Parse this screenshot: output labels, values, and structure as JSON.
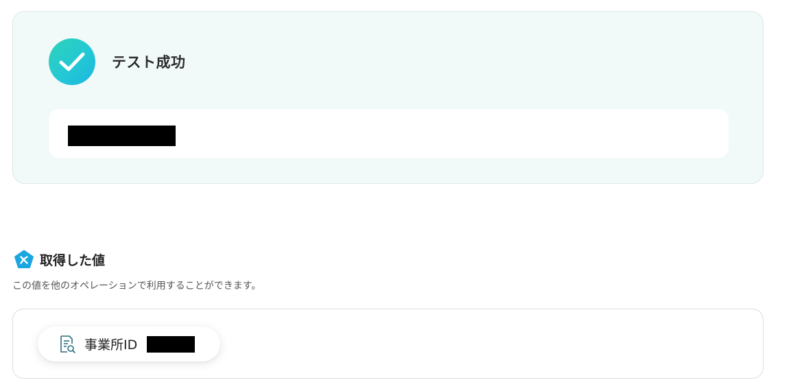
{
  "success": {
    "title": "テスト成功",
    "result_text": "",
    "icon": "check-icon",
    "accent_colors": [
      "#2fd3b8",
      "#1bb6e0"
    ]
  },
  "retrieved": {
    "icon": "yoom-logo-icon",
    "title": "取得した値",
    "description": "この値を他のオペレーションで利用することができます。",
    "items": [
      {
        "icon": "document-search-icon",
        "label": "事業所ID",
        "value": ""
      }
    ]
  }
}
